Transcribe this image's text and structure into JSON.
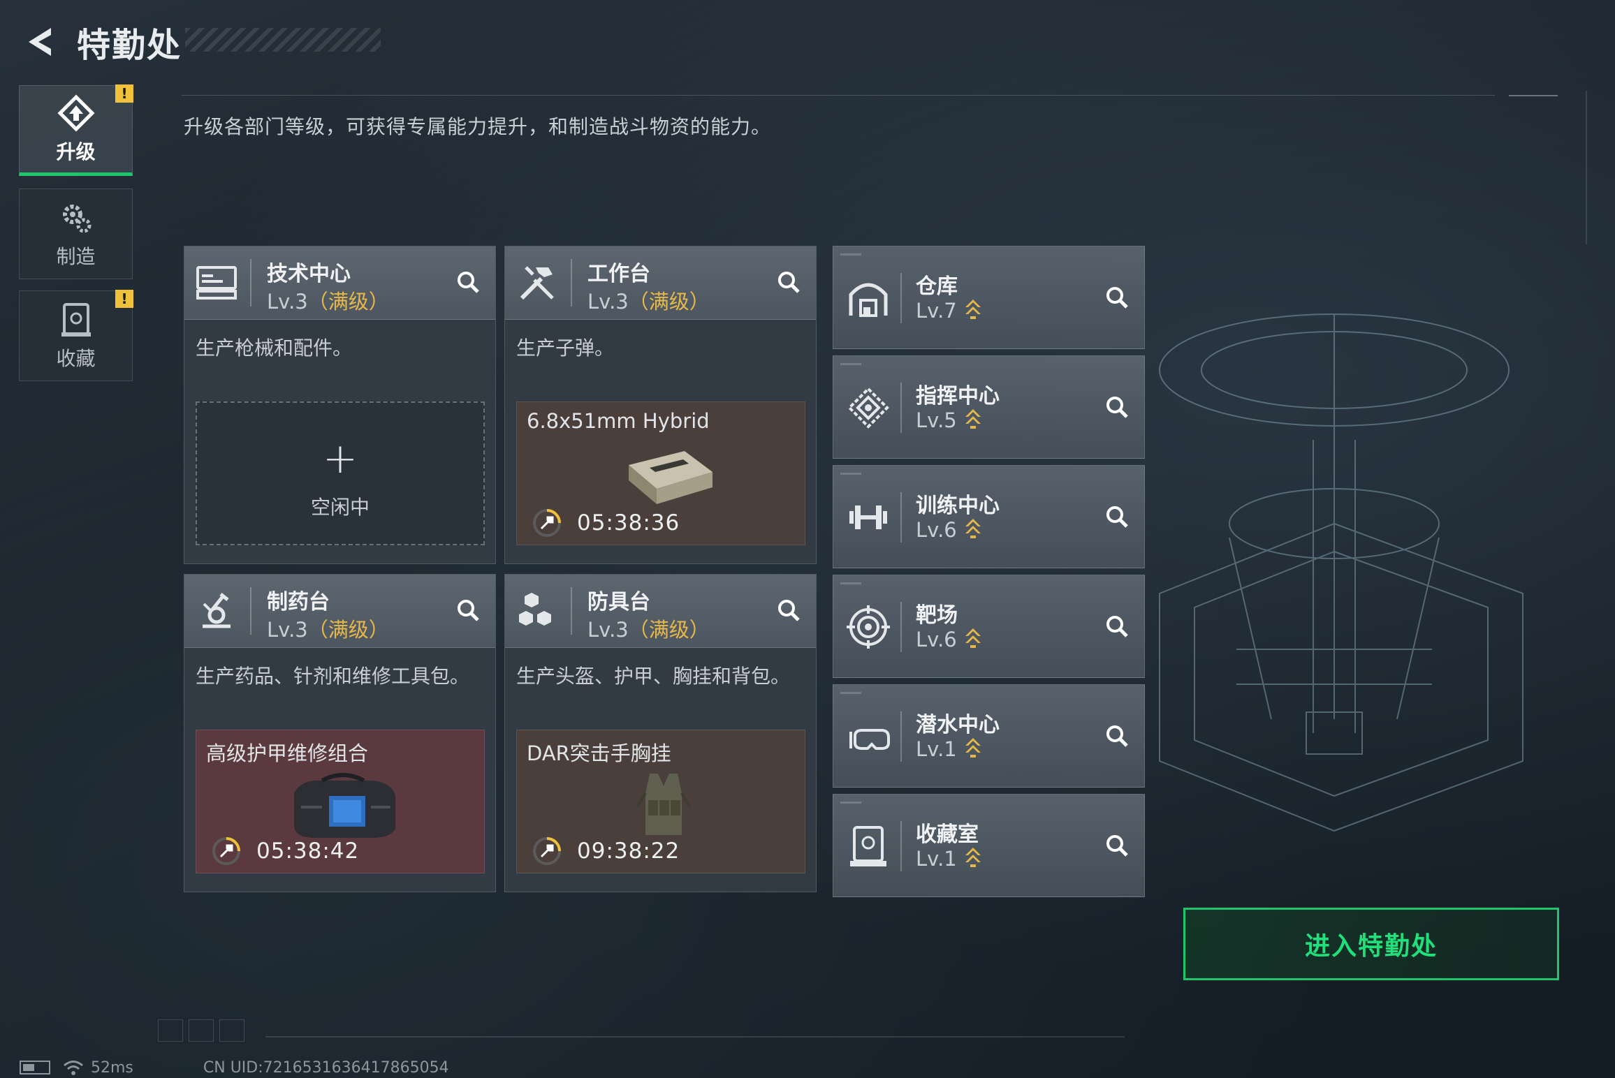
{
  "header": {
    "title": "特勤处"
  },
  "intro": "升级各部门等级，可获得专属能力提升，和制造战斗物资的能力。",
  "nav": [
    {
      "label": "升级",
      "icon": "upgrade-icon",
      "active": true,
      "badge": "!"
    },
    {
      "label": "制造",
      "icon": "gear-icon",
      "active": false
    },
    {
      "label": "收藏",
      "icon": "collection-icon",
      "active": false,
      "badge": "!"
    }
  ],
  "cards": [
    {
      "name": "技术中心",
      "level": "Lv.3",
      "max_tag": "（满级）",
      "desc": "生产枪械和配件。",
      "icon": "tech-center-icon",
      "slot": {
        "state": "idle",
        "plus": "+",
        "label": "空闲中"
      }
    },
    {
      "name": "工作台",
      "level": "Lv.3",
      "max_tag": "（满级）",
      "desc": "生产子弹。",
      "icon": "workbench-icon",
      "slot": {
        "state": "busy",
        "item": "6.8x51mm Hybrid",
        "timer": "05:38:36",
        "image": "ammo-box-image"
      }
    },
    {
      "name": "制药台",
      "level": "Lv.3",
      "max_tag": "（满级）",
      "desc": "生产药品、针剂和维修工具包。",
      "icon": "pharmacy-icon",
      "slot": {
        "state": "busy",
        "item": "高级护甲维修组合",
        "timer": "05:38:42",
        "image": "repair-kit-bag-image"
      }
    },
    {
      "name": "防具台",
      "level": "Lv.3",
      "max_tag": "（满级）",
      "desc": "生产头盔、护甲、胸挂和背包。",
      "icon": "armor-bench-icon",
      "slot": {
        "state": "busy",
        "item": "DAR突击手胸挂",
        "timer": "09:38:22",
        "image": "chest-rig-image"
      }
    }
  ],
  "facilities": [
    {
      "name": "仓库",
      "level": "Lv.7",
      "icon": "warehouse-icon"
    },
    {
      "name": "指挥中心",
      "level": "Lv.5",
      "icon": "command-center-icon"
    },
    {
      "name": "训练中心",
      "level": "Lv.6",
      "icon": "dumbbell-icon"
    },
    {
      "name": "靶场",
      "level": "Lv.6",
      "icon": "target-icon"
    },
    {
      "name": "潜水中心",
      "level": "Lv.1",
      "icon": "diving-mask-icon"
    },
    {
      "name": "收藏室",
      "level": "Lv.1",
      "icon": "collection-room-icon"
    }
  ],
  "enter_button": "进入特勤处",
  "footer": {
    "ping": "52ms",
    "uid": "CN UID:7216531636417865054"
  },
  "colors": {
    "accent_green": "#1fc56a",
    "max_level_gold": "#e6b84a",
    "warning_yellow": "#f0c23c"
  }
}
